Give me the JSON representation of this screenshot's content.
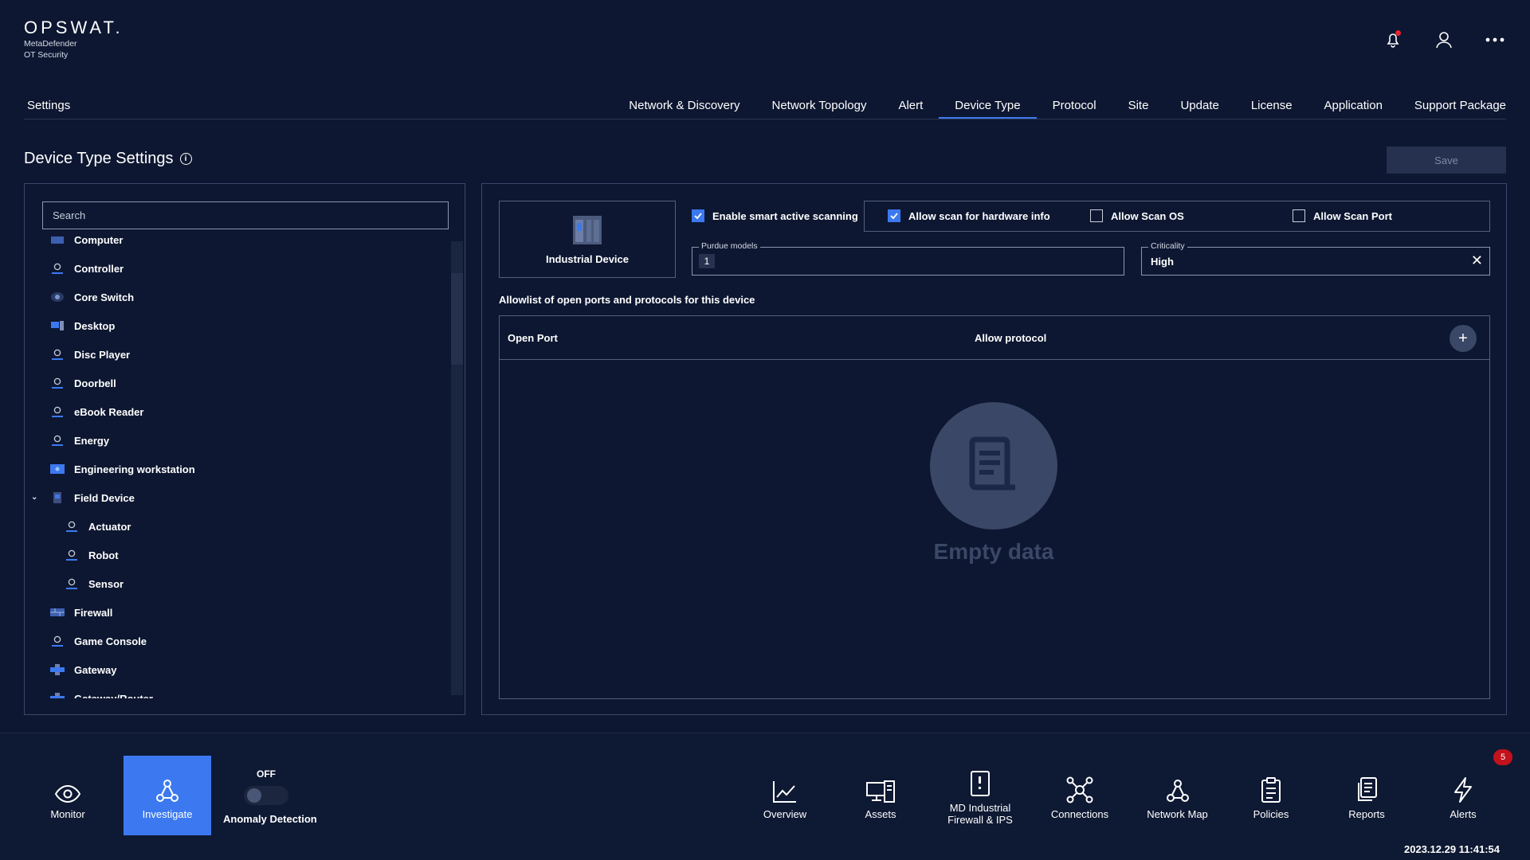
{
  "brand": {
    "name": "OPSWAT.",
    "line1": "MetaDefender",
    "line2": "OT Security"
  },
  "nav": {
    "settings": "Settings",
    "tabs": [
      {
        "label": "Network & Discovery"
      },
      {
        "label": "Network Topology"
      },
      {
        "label": "Alert"
      },
      {
        "label": "Device Type",
        "active": true
      },
      {
        "label": "Protocol"
      },
      {
        "label": "Site"
      },
      {
        "label": "Update"
      },
      {
        "label": "License"
      },
      {
        "label": "Application"
      },
      {
        "label": "Support Package"
      }
    ]
  },
  "page": {
    "title": "Device Type Settings",
    "save_label": "Save"
  },
  "search": {
    "placeholder": "Search"
  },
  "device_list": [
    {
      "label": "Computer",
      "icon": "computer-icon"
    },
    {
      "label": "Controller",
      "icon": "person-icon"
    },
    {
      "label": "Core Switch",
      "icon": "switch-icon"
    },
    {
      "label": "Desktop",
      "icon": "desktop-icon"
    },
    {
      "label": "Disc Player",
      "icon": "person-icon"
    },
    {
      "label": "Doorbell",
      "icon": "person-icon"
    },
    {
      "label": "eBook Reader",
      "icon": "person-icon"
    },
    {
      "label": "Energy",
      "icon": "person-icon"
    },
    {
      "label": "Engineering workstation",
      "icon": "workstation-icon"
    },
    {
      "label": "Field Device",
      "icon": "field-device-icon",
      "expanded": true
    },
    {
      "label": "Actuator",
      "icon": "person-icon",
      "child": true
    },
    {
      "label": "Robot",
      "icon": "person-icon",
      "child": true
    },
    {
      "label": "Sensor",
      "icon": "person-icon",
      "child": true
    },
    {
      "label": "Firewall",
      "icon": "firewall-icon"
    },
    {
      "label": "Game Console",
      "icon": "person-icon"
    },
    {
      "label": "Gateway",
      "icon": "gateway-icon"
    },
    {
      "label": "Gateway/Router",
      "icon": "gateway-icon"
    }
  ],
  "detail": {
    "device_name": "Industrial Device",
    "enable_smart": "Enable smart active scanning",
    "allow_hw": "Allow scan for hardware info",
    "allow_os": "Allow Scan OS",
    "allow_port": "Allow Scan Port",
    "purdue_label": "Purdue models",
    "purdue_value": "1",
    "criticality_label": "Criticality",
    "criticality_value": "High",
    "allowlist_text": "Allowlist of open ports and protocols for this device",
    "col_port": "Open Port",
    "col_protocol": "Allow protocol",
    "empty_text": "Empty data"
  },
  "bottom": {
    "monitor": "Monitor",
    "investigate": "Investigate",
    "off": "OFF",
    "anomaly": "Anomaly Detection",
    "overview": "Overview",
    "assets": "Assets",
    "mdfw_line1": "MD Industrial",
    "mdfw_line2": "Firewall & IPS",
    "connections": "Connections",
    "network_map": "Network Map",
    "policies": "Policies",
    "reports": "Reports",
    "alerts": "Alerts",
    "alert_count": "5",
    "timestamp": "2023.12.29 11:41:54"
  },
  "colors": {
    "background": "#0d1731",
    "accent": "#3c79f0",
    "alert_badge": "#c2121c"
  }
}
